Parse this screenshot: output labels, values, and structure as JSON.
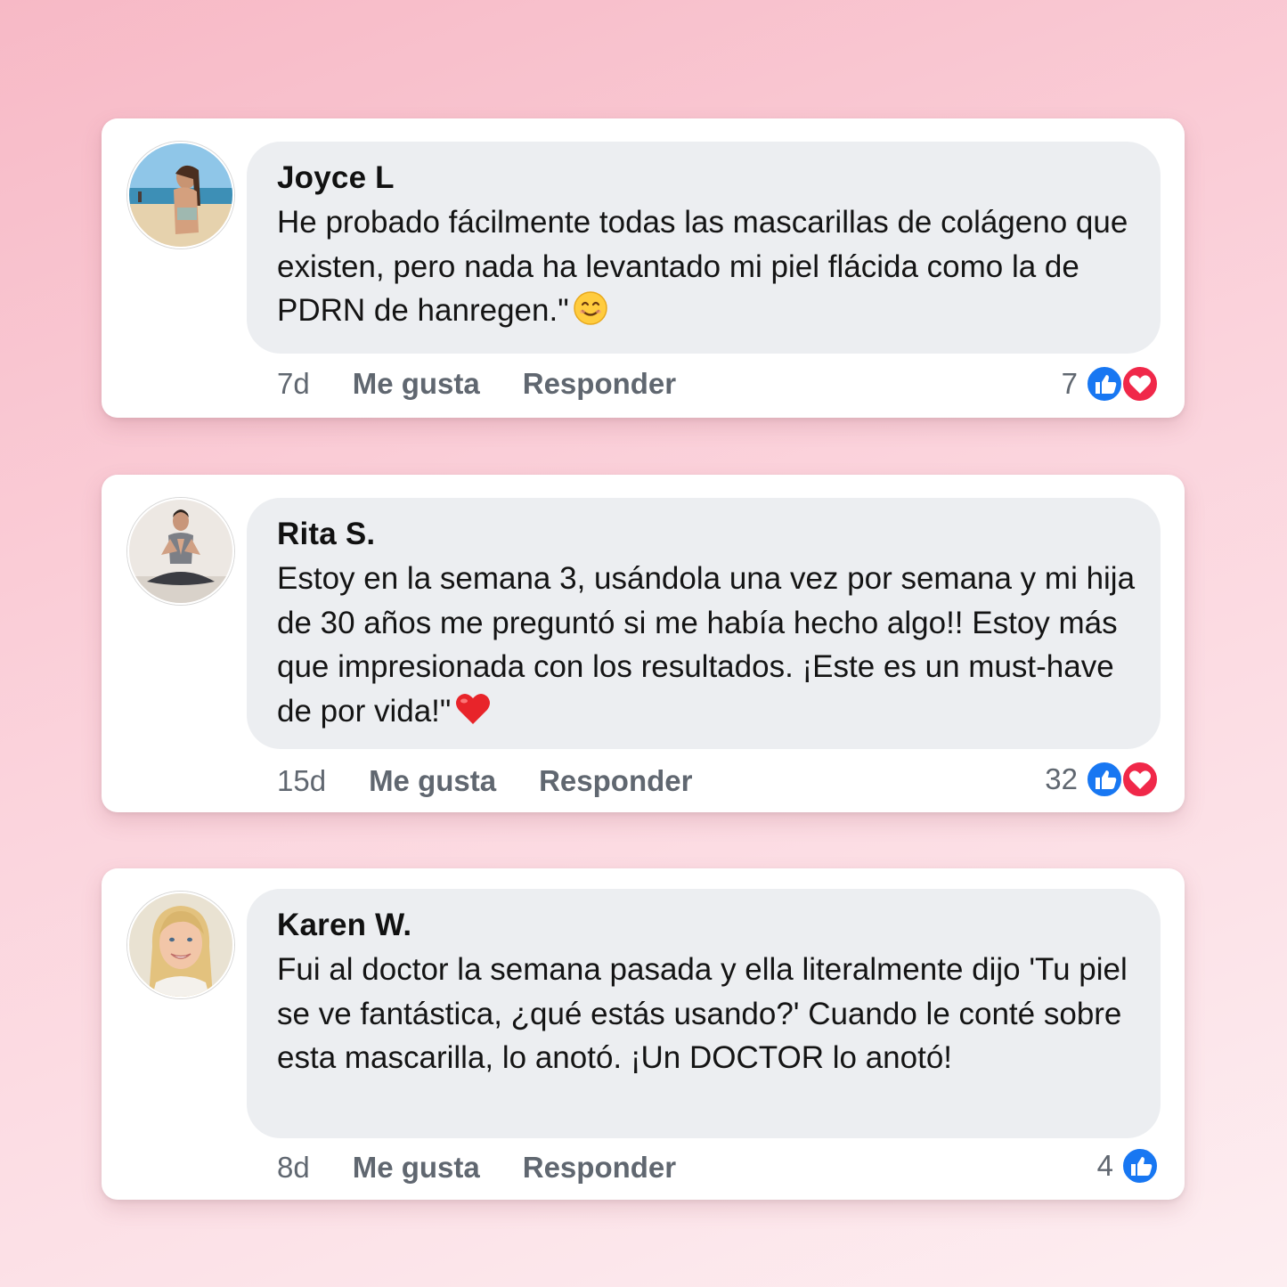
{
  "comments": [
    {
      "author": "Joyce L",
      "text": "He probado fácilmente todas las mascarillas de colágeno que existen, pero nada ha levantado mi piel flácida como la de PDRN de hanregen.\"",
      "emoji": "smiling-face-emoji",
      "time": "7d",
      "like_label": "Me gusta",
      "reply_label": "Responder",
      "reaction_count": "7",
      "reactions": [
        "like",
        "love"
      ]
    },
    {
      "author": "Rita S.",
      "text": "Estoy en la semana 3, usándola una vez por semana y mi hija de 30 años me preguntó si me había hecho algo!! Estoy más que impresionada con los resultados. ¡Este es un must-have de por vida!\"",
      "emoji": "red-heart-emoji",
      "time": "15d",
      "like_label": "Me gusta",
      "reply_label": "Responder",
      "reaction_count": "32",
      "reactions": [
        "like",
        "love"
      ]
    },
    {
      "author": "Karen W.",
      "text": "Fui al doctor la semana pasada y ella literalmente dijo 'Tu piel se ve fantástica, ¿qué estás usando?' Cuando le conté sobre esta mascarilla, lo anotó. ¡Un DOCTOR lo anotó!",
      "time": "8d",
      "like_label": "Me gusta",
      "reply_label": "Responder",
      "reaction_count": "4",
      "reactions": [
        "like"
      ]
    }
  ],
  "colors": {
    "like_blue": "#1877f2",
    "love_red": "#f02849",
    "bubble_gray": "#eceef1",
    "meta_gray": "#606770"
  }
}
